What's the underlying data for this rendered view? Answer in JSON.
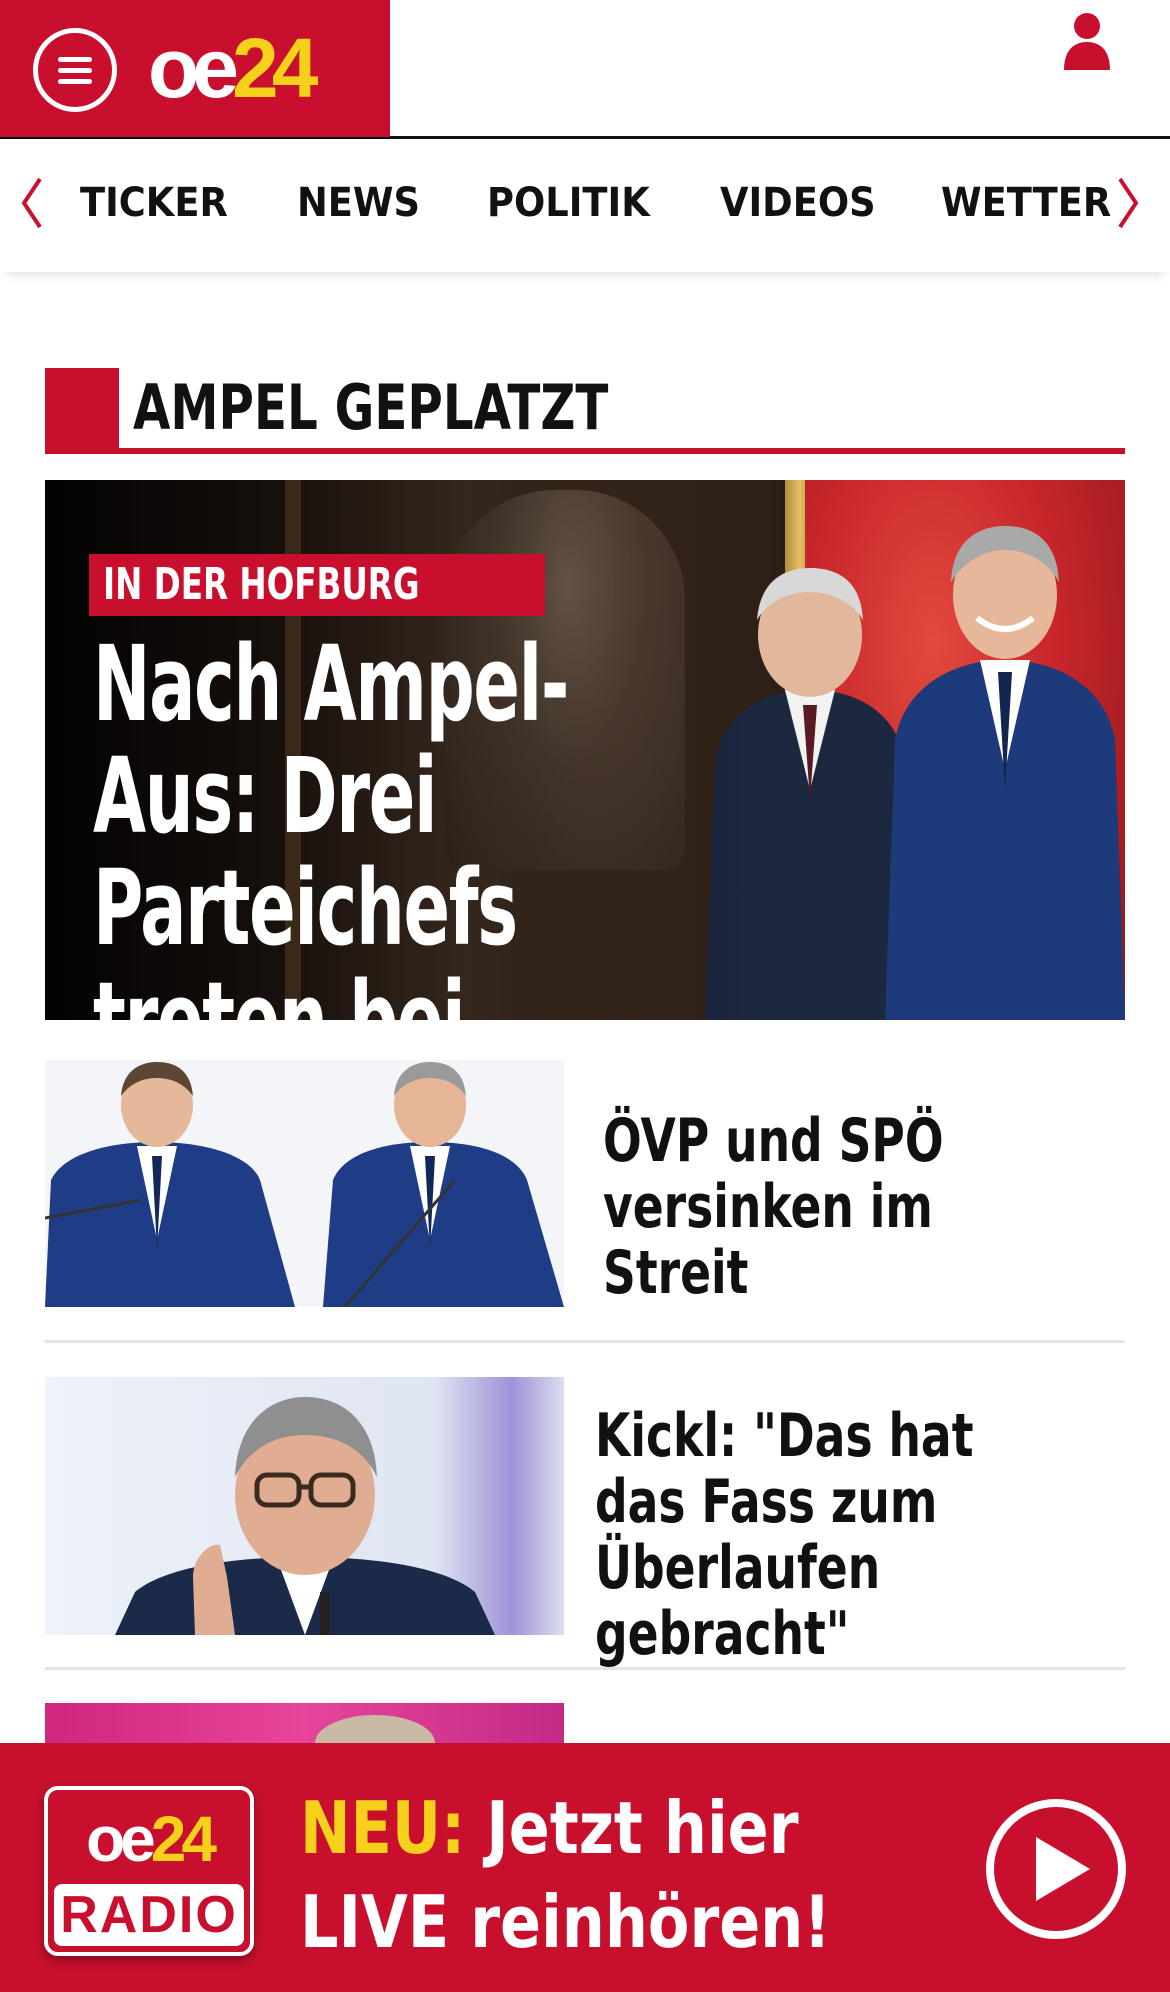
{
  "header": {
    "logo_main": "oe",
    "logo_accent": "24"
  },
  "nav": {
    "items": [
      {
        "label": "TICKER"
      },
      {
        "label": "NEWS"
      },
      {
        "label": "POLITIK"
      },
      {
        "label": "VIDEOS"
      },
      {
        "label": "WETTER"
      }
    ]
  },
  "section": {
    "title": "AMPEL GEPLATZT"
  },
  "hero": {
    "kicker": "IN DER HOFBURG",
    "title": "Nach Ampel-Aus: Drei Parteichefs treten bei VdB an"
  },
  "articles": [
    {
      "title": "ÖVP und SPÖ versinken im Streit"
    },
    {
      "title": "Kickl: \"Das hat das Fass zum Überlaufen gebracht\""
    }
  ],
  "radio_banner": {
    "logo_main": "oe",
    "logo_accent": "24",
    "logo_tag": "RADIO",
    "promo_highlight": "NEU:",
    "promo_line1": "Jetzt hier",
    "promo_line2": "LIVE reinhören!"
  },
  "colors": {
    "brand_red": "#c8102e",
    "brand_yellow": "#f5d11b"
  },
  "icons": [
    "menu-icon",
    "user-icon",
    "chevron-left-icon",
    "chevron-right-icon",
    "play-icon"
  ]
}
